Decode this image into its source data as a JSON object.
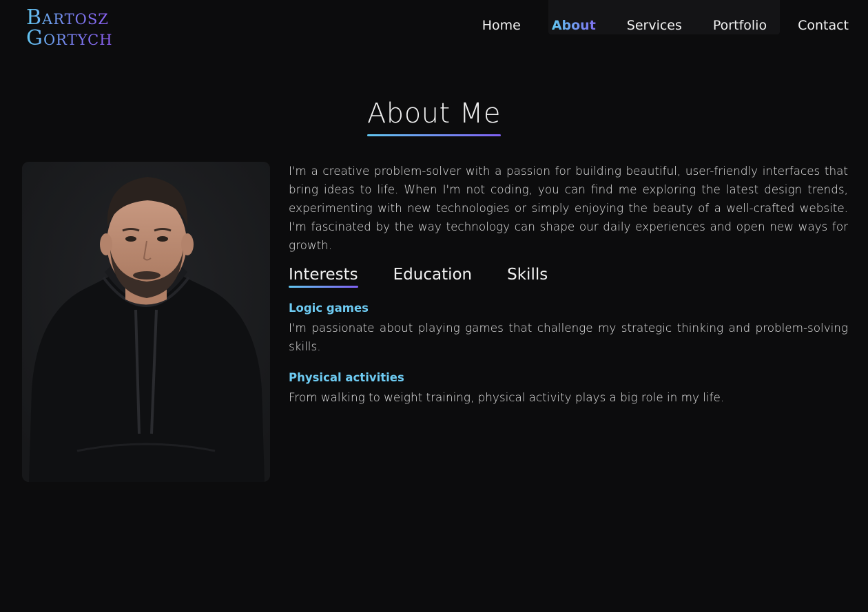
{
  "header": {
    "logo_line1": "Bartosz",
    "logo_line2": "Gortych",
    "nav": [
      {
        "label": "Home",
        "active": false
      },
      {
        "label": "About",
        "active": true
      },
      {
        "label": "Services",
        "active": false
      },
      {
        "label": "Portfolio",
        "active": false
      },
      {
        "label": "Contact",
        "active": false
      }
    ]
  },
  "about": {
    "title": "About Me",
    "intro": "I'm a creative problem-solver with a passion for building beautiful, user-friendly interfaces that bring ideas to life. When I'm not coding, you can find me exploring the latest design trends, experimenting with new technologies or simply enjoying the beauty of a well-crafted website. I'm fascinated by the way technology can shape our daily experiences and open new ways for growth.",
    "tabs": [
      {
        "label": "Interests",
        "active": true
      },
      {
        "label": "Education",
        "active": false
      },
      {
        "label": "Skills",
        "active": false
      }
    ],
    "interests": [
      {
        "title": "Logic games",
        "text": "I'm passionate about playing games that challenge my strategic thinking and problem-solving skills."
      },
      {
        "title": "Physical activities",
        "text": "From walking to weight training, physical activity plays a big role in my life."
      }
    ]
  },
  "colors": {
    "background": "#0c0c0d",
    "accent_start": "#62c6f0",
    "accent_end": "#7f60f2",
    "heading_accent": "#6ecbf2"
  }
}
